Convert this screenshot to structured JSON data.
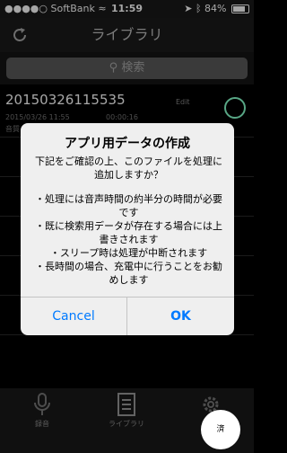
{
  "status_bar": {
    "carrier": "SoftBank",
    "time": "11:59",
    "battery": "84%",
    "battery_fraction": 0.84
  },
  "nav": {
    "title": "ライブラリ"
  },
  "search": {
    "placeholder": "検索"
  },
  "list": {
    "items": [
      {
        "title": "20150326115535",
        "date": "2015/03/26 11:55",
        "duration": "00:00:16",
        "subtitle": "音質",
        "action": "Edit"
      }
    ]
  },
  "tabbar": {
    "items": [
      {
        "label": "録音",
        "icon": "microphone-icon"
      },
      {
        "label": "ライブラリ",
        "icon": "library-list-icon"
      },
      {
        "label": "設定",
        "icon": "gear-icon"
      }
    ]
  },
  "dialog": {
    "title": "アプリ用データの作成",
    "message": "下記をご確認の上、このファイルを処理に追加しますか？",
    "notes": [
      "・処理には音声時間の約半分の時間が必要です",
      "・既に検索用データが存在する場合には上書きされます",
      "・スリープ時は処理が中断されます",
      "・長時間の場合、充電中に行うことをお勧めします"
    ],
    "cancel_label": "Cancel",
    "ok_label": "OK"
  },
  "badge": {
    "text": "済"
  },
  "colors": {
    "accent": "#007aff"
  }
}
